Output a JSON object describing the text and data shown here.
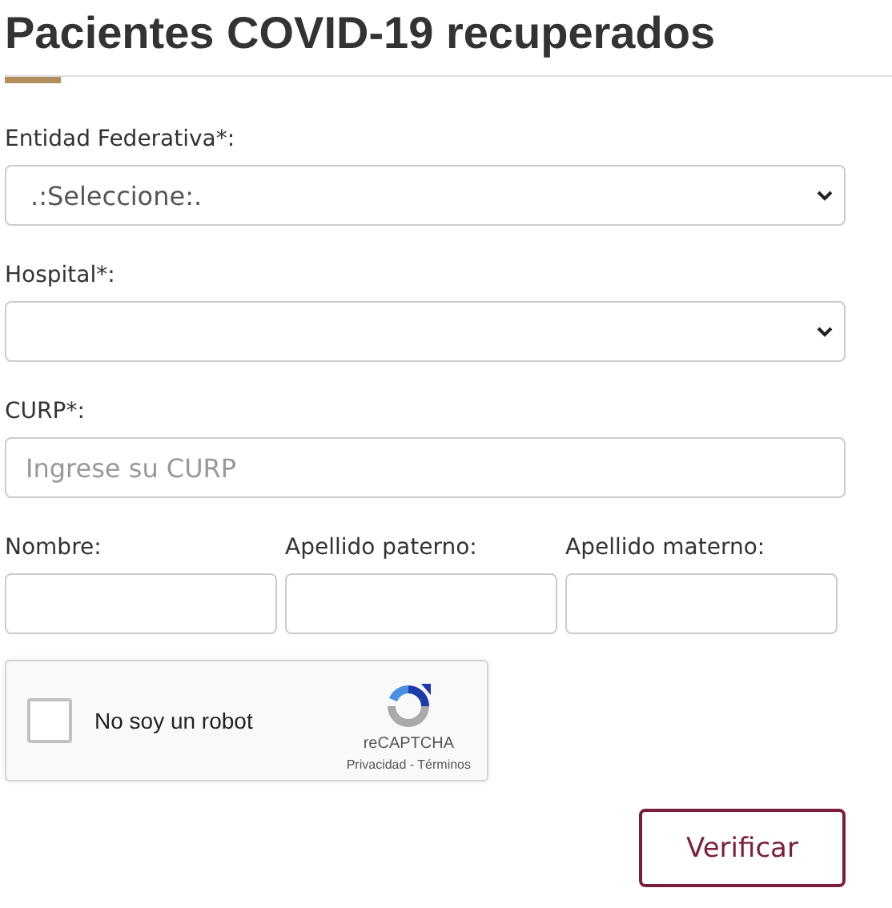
{
  "title": "Pacientes COVID-19 recuperados",
  "fields": [
    {
      "kind": "select",
      "label": "Entidad Federativa*:",
      "value": ".:Seleccione:."
    },
    {
      "kind": "select",
      "label": "Hospital*:"
    },
    {
      "kind": "input",
      "label": "CURP*:",
      "placeholder": "Ingrese su CURP"
    }
  ],
  "name_fields": [
    {
      "label": "Nombre:"
    },
    {
      "label": "Apellido paterno:"
    },
    {
      "label": "Apellido materno:"
    }
  ],
  "captcha": {
    "label": "No soy un robot",
    "checked": false,
    "brand": "reCAPTCHA",
    "footer": "Privacidad - Términos"
  },
  "button": "Verificar"
}
